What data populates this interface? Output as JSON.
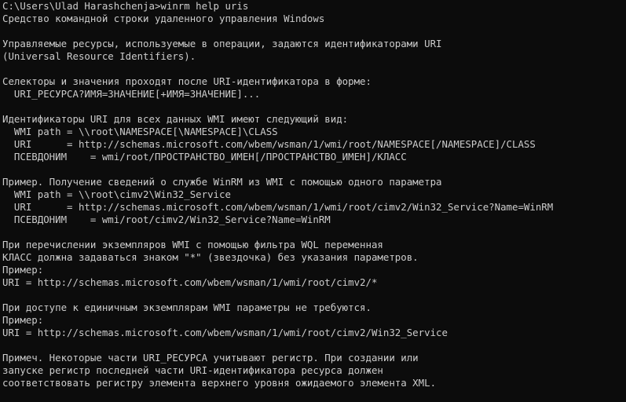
{
  "terminal": {
    "lines": [
      "C:\\Users\\Ulad Harashchenja>winrm help uris",
      "Средство командной строки удаленного управления Windows",
      "",
      "Управляемые ресурсы, используемые в операции, задаются идентификаторами URI",
      "(Universal Resource Identifiers).",
      "",
      "Селекторы и значения проходят после URI-идентификатора в форме:",
      "  URI_РЕСУРСА?ИМЯ=ЗНАЧЕНИЕ[+ИМЯ=ЗНАЧЕНИЕ]...",
      "",
      "Идентификаторы URI для всех данных WMI имеют следующий вид:",
      "  WMI path = \\\\root\\NAMESPACE[\\NAMESPACE]\\CLASS",
      "  URI      = http://schemas.microsoft.com/wbem/wsman/1/wmi/root/NAMESPACE[/NAMESPACE]/CLASS",
      "  ПСЕВДОНИМ    = wmi/root/ПРОСТРАНСТВО_ИМЕН[/ПРОСТРАНСТВО_ИМЕН]/КЛАСС",
      "",
      "Пример. Получение сведений о службе WinRM из WMI с помощью одного параметра",
      "  WMI path = \\\\root\\cimv2\\Win32_Service",
      "  URI      = http://schemas.microsoft.com/wbem/wsman/1/wmi/root/cimv2/Win32_Service?Name=WinRM",
      "  ПСЕВДОНИМ    = wmi/root/cimv2/Win32_Service?Name=WinRM",
      "",
      "При перечислении экземпляров WMI с помощью фильтра WQL переменная",
      "КЛАСС должна задаваться знаком \"*\" (звездочка) без указания параметров.",
      "Пример:",
      "URI = http://schemas.microsoft.com/wbem/wsman/1/wmi/root/cimv2/*",
      "",
      "При доступе к единичным экземплярам WMI параметры не требуются.",
      "Пример:",
      "URI = http://schemas.microsoft.com/wbem/wsman/1/wmi/root/cimv2/Win32_Service",
      "",
      "Примеч. Некоторые части URI_РЕСУРСА учитывают регистр. При создании или",
      "запуске регистр последней части URI-идентификатора ресурса должен",
      "соответствовать регистру элемента верхнего уровня ожидаемого элемента XML."
    ]
  }
}
